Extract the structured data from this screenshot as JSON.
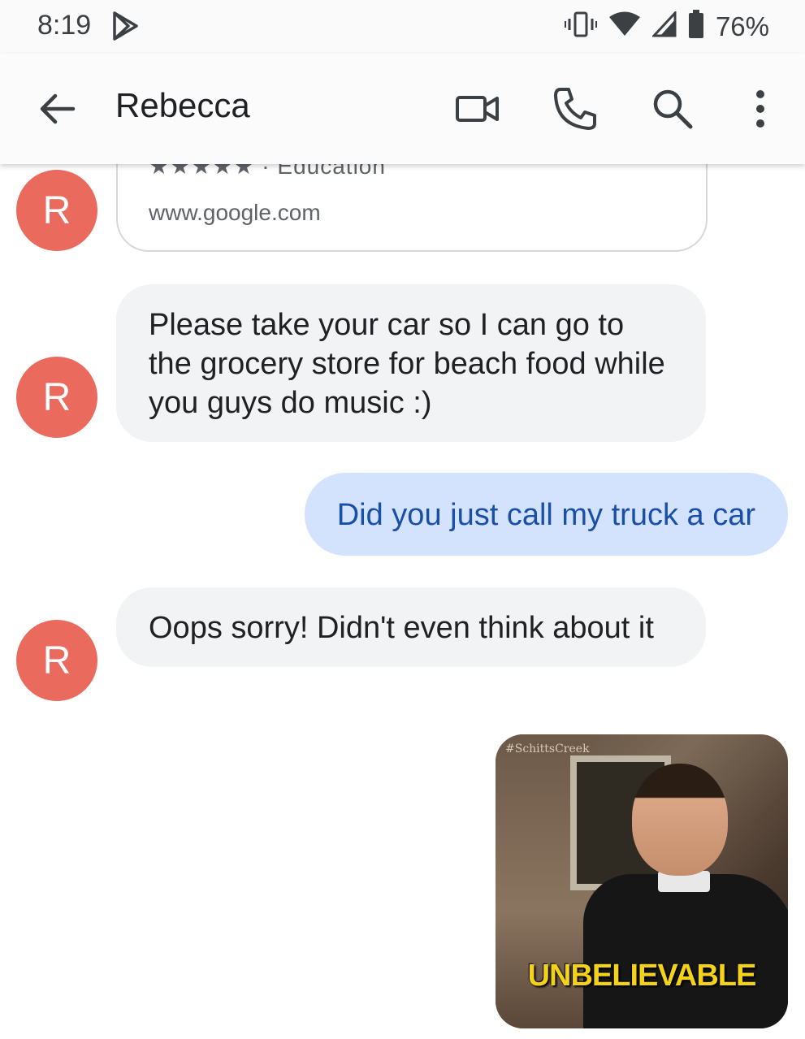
{
  "status_bar": {
    "time": "8:19",
    "battery": "76%",
    "icons": [
      "play-store-icon",
      "vibrate-icon",
      "wifi-icon",
      "signal-icon",
      "battery-icon"
    ]
  },
  "app_bar": {
    "contact_name": "Rebecca",
    "icons": [
      "back-arrow-icon",
      "video-call-icon",
      "phone-icon",
      "search-icon",
      "more-vert-icon"
    ]
  },
  "messages": [
    {
      "type": "link_card",
      "direction": "incoming",
      "avatar": "R",
      "meta": "★★★★★ · Education",
      "url": "www.google.com"
    },
    {
      "type": "text",
      "direction": "incoming",
      "avatar": "R",
      "text": "Please take your car so I can go to the grocery store for beach food while you guys do music :)"
    },
    {
      "type": "text",
      "direction": "outgoing",
      "text": "Did you just call my truck a car"
    },
    {
      "type": "text",
      "direction": "incoming",
      "avatar": "R",
      "text": "Oops sorry! Didn't even think about it"
    },
    {
      "type": "gif",
      "direction": "outgoing",
      "watermark": "#SchittsCreek",
      "caption": "UNBELIEVABLE"
    }
  ],
  "colors": {
    "avatar": "#ea6a5e",
    "incoming_bubble": "#f1f3f4",
    "outgoing_bubble": "#d3e3fd",
    "outgoing_text": "#1a4fa8"
  }
}
